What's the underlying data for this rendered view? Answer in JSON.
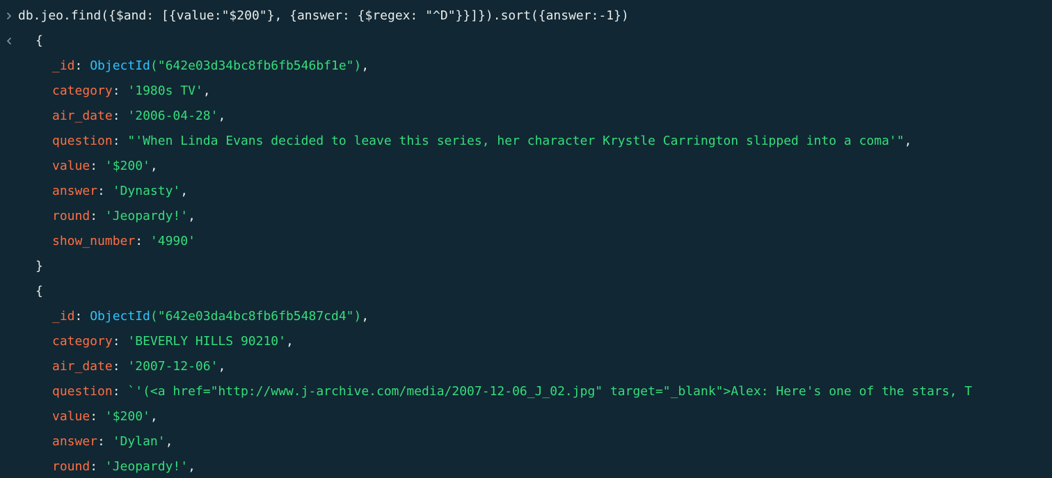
{
  "colors": {
    "background": "#112733",
    "key": "#ff6f44",
    "string": "#35de7b",
    "function": "#2dc4ff",
    "text": "#e8edeb"
  },
  "icons": {
    "input_prompt": "chevron-right-icon",
    "output_marker": "chevron-left-icon"
  },
  "command": "db.jeo.find({$and: [{value:\"$200\"}, {answer: {$regex: \"^D\"}}]}).sort({answer:-1})",
  "results": [
    {
      "open_brace": "{",
      "close_brace": "}",
      "fields": [
        {
          "key": "_id",
          "func": "ObjectId",
          "value": "(\"642e03d34bc8fb6fb546bf1e\")",
          "trail": ","
        },
        {
          "key": "category",
          "value": "'1980s TV'",
          "trail": ","
        },
        {
          "key": "air_date",
          "value": "'2006-04-28'",
          "trail": ","
        },
        {
          "key": "question",
          "value": "\"'When Linda Evans decided to leave this series, her character Krystle Carrington slipped into a coma'\"",
          "trail": ","
        },
        {
          "key": "value",
          "value": "'$200'",
          "trail": ","
        },
        {
          "key": "answer",
          "value": "'Dynasty'",
          "trail": ","
        },
        {
          "key": "round",
          "value": "'Jeopardy!'",
          "trail": ","
        },
        {
          "key": "show_number",
          "value": "'4990'",
          "trail": ""
        }
      ]
    },
    {
      "open_brace": "{",
      "fields": [
        {
          "key": "_id",
          "func": "ObjectId",
          "value": "(\"642e03da4bc8fb6fb5487cd4\")",
          "trail": ","
        },
        {
          "key": "category",
          "value": "'BEVERLY HILLS 90210'",
          "trail": ","
        },
        {
          "key": "air_date",
          "value": "'2007-12-06'",
          "trail": ","
        },
        {
          "key": "question",
          "value": "`'(<a href=\"http://www.j-archive.com/media/2007-12-06_J_02.jpg\" target=\"_blank\">Alex: Here's one of the stars, T",
          "trail": ""
        },
        {
          "key": "value",
          "value": "'$200'",
          "trail": ","
        },
        {
          "key": "answer",
          "value": "'Dylan'",
          "trail": ","
        },
        {
          "key": "round",
          "value": "'Jeopardy!'",
          "trail": ","
        }
      ]
    }
  ]
}
